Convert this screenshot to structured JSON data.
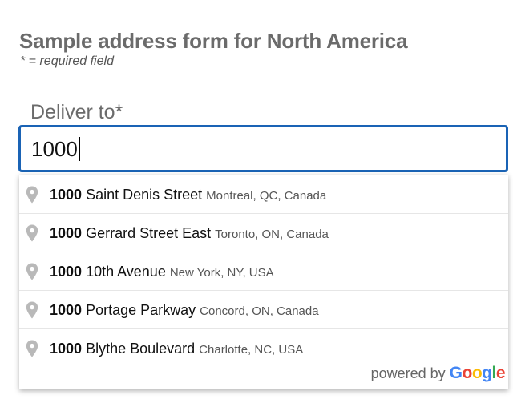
{
  "form": {
    "title": "Sample address form for North America",
    "required_note": "* = required field",
    "deliver_label": "Deliver to*",
    "input_value": "1000"
  },
  "suggestions": [
    {
      "number": "1000",
      "street": "Saint Denis Street",
      "secondary": "Montreal, QC, Canada"
    },
    {
      "number": "1000",
      "street": "Gerrard Street East",
      "secondary": "Toronto, ON, Canada"
    },
    {
      "number": "1000",
      "street": "10th Avenue",
      "secondary": "New York, NY, USA"
    },
    {
      "number": "1000",
      "street": "Portage Parkway",
      "secondary": "Concord, ON, Canada"
    },
    {
      "number": "1000",
      "street": "Blythe Boulevard",
      "secondary": "Charlotte, NC, USA"
    }
  ],
  "attribution": {
    "powered_by": "powered by",
    "logo_letters": [
      "G",
      "o",
      "o",
      "g",
      "l",
      "e"
    ]
  },
  "colors": {
    "input_border": "#1a63b5",
    "google_blue": "#4285F4",
    "google_red": "#EA4335",
    "google_yellow": "#FBBC05",
    "google_green": "#34A853"
  },
  "icons": {
    "suggestion_icon": "map-pin-icon"
  }
}
